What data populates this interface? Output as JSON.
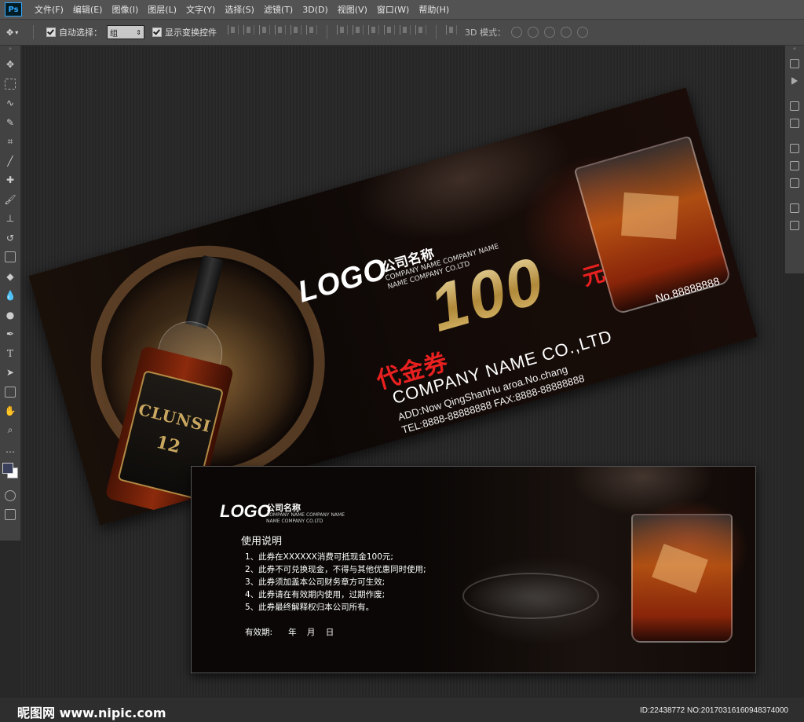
{
  "app": {
    "logo_text": "Ps"
  },
  "menu": [
    "文件(F)",
    "编辑(E)",
    "图像(I)",
    "图层(L)",
    "文字(Y)",
    "选择(S)",
    "滤镜(T)",
    "3D(D)",
    "视图(V)",
    "窗口(W)",
    "帮助(H)"
  ],
  "options": {
    "auto_select_label": "自动选择：",
    "auto_select_value": "组",
    "show_transform_label": "显示变换控件",
    "mode_3d_label": "3D 模式："
  },
  "voucher_front": {
    "logo": "LOGO",
    "company_cn": "公司名称",
    "company_en": "COMPANY NAME COMPANY NAME NAME COMPANY CO.LTD",
    "amount": "100",
    "currency": "元",
    "voucher_label": "代金券",
    "company_name_big": "COMPANY NAME CO.,LTD",
    "address": "ADD:Now QingShanHu aroa.No.chang",
    "tel_fax": "TEL:8888-88888888  FAX:8888-88888888",
    "serial": "No.88888888",
    "bottle_brand": "CLUNSI",
    "bottle_age": "12"
  },
  "voucher_back": {
    "logo": "LOGO",
    "company_cn": "公司名称",
    "company_en": "COMPANY NAME COMPANY NAME NAME COMPANY CO.LTD",
    "usage_title": "使用说明",
    "rules": [
      "1、此券在XXXXXX消费可抵现金100元;",
      "2、此券不可兑换现金，不得与其他优惠同时使用;",
      "3、此券须加盖本公司财务章方可生效;",
      "4、此券请在有效期内使用，过期作废;",
      "5、此券最终解释权归本公司所有。"
    ],
    "validity": "有效期:      年    月    日"
  },
  "footer": {
    "site": "昵图网 www.nipic.com",
    "id_text": "ID:22438772 NO:20170316160948374000"
  },
  "colors": {
    "menu_bg": "#535353",
    "canvas_bg": "#282828",
    "accent_red": "#e82020",
    "gold": "#c9a760"
  }
}
